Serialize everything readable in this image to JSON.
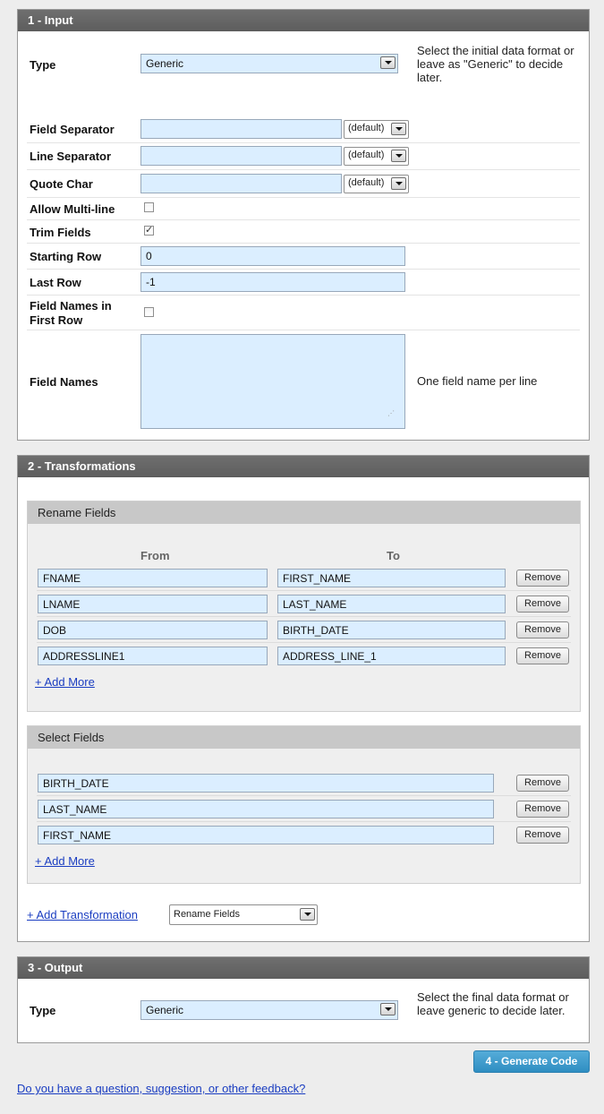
{
  "input": {
    "title": "1 - Input",
    "type_label": "Type",
    "type_value": "Generic",
    "type_help": "Select the initial data format or leave as \"Generic\" to decide later.",
    "field_separator_label": "Field Separator",
    "line_separator_label": "Line Separator",
    "quote_char_label": "Quote Char",
    "default_option": "(default)",
    "allow_multiline_label": "Allow Multi-line",
    "allow_multiline_checked": false,
    "trim_fields_label": "Trim Fields",
    "trim_fields_checked": true,
    "starting_row_label": "Starting Row",
    "starting_row_value": "0",
    "last_row_label": "Last Row",
    "last_row_value": "-1",
    "field_names_first_row_label": "Field Names in First Row",
    "field_names_first_row_checked": false,
    "field_names_label": "Field Names",
    "field_names_help": "One field name per line",
    "check_mark": "✓"
  },
  "transformations": {
    "title": "2 - Transformations",
    "rename": {
      "title": "Rename Fields",
      "from_header": "From",
      "to_header": "To",
      "rows": [
        {
          "from": "FNAME",
          "to": "FIRST_NAME"
        },
        {
          "from": "LNAME",
          "to": "LAST_NAME"
        },
        {
          "from": "DOB",
          "to": "BIRTH_DATE"
        },
        {
          "from": "ADDRESSLINE1",
          "to": "ADDRESS_LINE_1"
        }
      ],
      "add_more": "+ Add More"
    },
    "select": {
      "title": "Select Fields",
      "rows": [
        "BIRTH_DATE",
        "LAST_NAME",
        "FIRST_NAME"
      ],
      "add_more": "+ Add More"
    },
    "remove_label": "Remove",
    "add_transformation": "+ Add Transformation",
    "transformation_type": "Rename Fields"
  },
  "output": {
    "title": "3 - Output",
    "type_label": "Type",
    "type_value": "Generic",
    "type_help": "Select the final data format or leave generic to decide later."
  },
  "generate_button": "4 - Generate Code",
  "feedback_link": "Do you have a question, suggestion, or other feedback?"
}
